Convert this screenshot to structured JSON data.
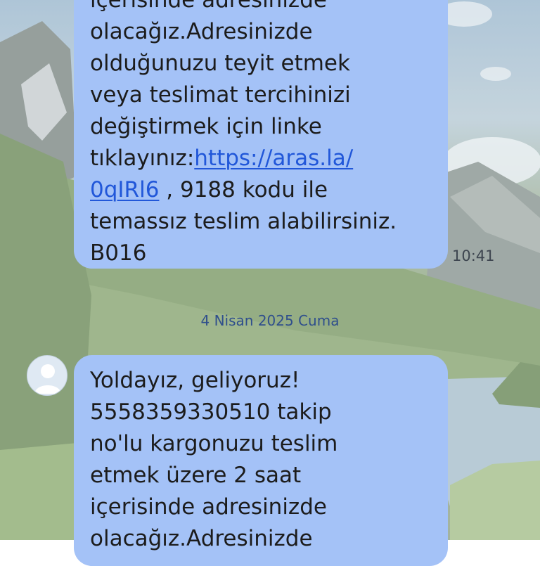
{
  "messages": [
    {
      "lines_before_link": [
        "içerisinde adresinizde",
        "olacağız.Adresinizde",
        "olduğunuzu teyit etmek",
        "veya teslimat tercihinizi",
        "değiştirmek için linke"
      ],
      "link_prefix": "tıklayınız:",
      "link_part1": "https://aras.la/",
      "link_part2": "0qIRl6",
      "after_link": " , 9188 kodu ile",
      "lines_after_link": [
        "temassız teslim alabilirsiniz.",
        "B016"
      ],
      "time": "10:41"
    },
    {
      "lines": [
        "Yoldayız, geliyoruz!",
        "5558359330510 takip",
        "no'lu kargonuzu teslim",
        "etmek üzere 2 saat",
        "içerisinde adresinizde",
        "olacağız.Adresinizde"
      ]
    }
  ],
  "date_separator": "4 Nisan 2025 Cuma",
  "icons": {
    "avatar": "contact-avatar-icon"
  },
  "colors": {
    "bubble": "#a4c2f7",
    "link": "#2157d9",
    "date_text": "#2f4f8c"
  }
}
